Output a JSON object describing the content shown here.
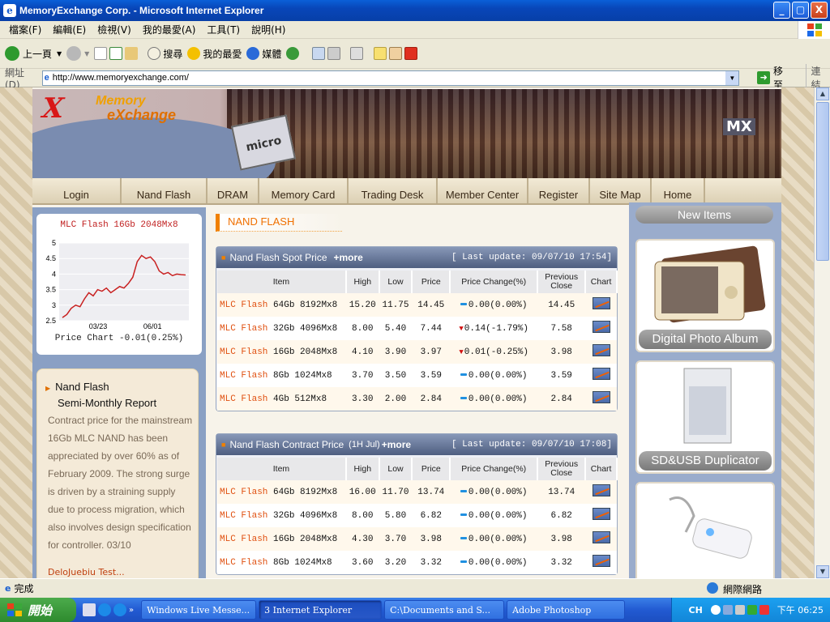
{
  "window": {
    "title": "MemoryExchange Corp. - Microsoft Internet Explorer",
    "min": "_",
    "max": "▢",
    "close": "X"
  },
  "menu": [
    "檔案(F)",
    "編輯(E)",
    "檢視(V)",
    "我的最愛(A)",
    "工具(T)",
    "說明(H)"
  ],
  "toolbar": {
    "back": "上一頁",
    "search": "搜尋",
    "favorites": "我的最愛",
    "media": "媒體"
  },
  "address": {
    "label": "網址(D)",
    "url": "http://www.memoryexchange.com/",
    "go": "移至",
    "links": "連結"
  },
  "site": {
    "logo_line1": "Memory",
    "logo_line2": "eXchange",
    "logo_x": "X",
    "banner_tag": "MX",
    "sd_label": "micro SD",
    "nav": [
      "Login",
      "Nand Flash",
      "DRAM",
      "Memory Card",
      "Trading Desk",
      "Member Center",
      "Register",
      "Site Map",
      "Home"
    ],
    "section_title": "NAND FLASH",
    "side_chart": {
      "title": "MLC Flash 16Gb 2048Mx8",
      "caption": "Price Chart -0.01(0.25%)"
    },
    "report": {
      "title": "Nand Flash",
      "subtitle": "Semi-Monthly Report",
      "body": "Contract price for the mainstream 16Gb MLC NAND has been appreciated by over 60% as of February 2009. The strong surge is driven by a straining supply due to process migration, which also involves design specification for controller. 03/10",
      "link": "DeloJuebiu Test..."
    },
    "spot": {
      "title": "Nand Flash Spot Price",
      "more": "+more",
      "update": "[ Last update: 09/07/10 17:54]"
    },
    "contract": {
      "title": "Nand Flash Contract Price",
      "sub": "(1H Jul)",
      "more": "+more",
      "update": "[ Last update: 09/07/10 17:08]"
    },
    "columns": [
      "Item",
      "High",
      "Low",
      "Price",
      "Price Change(%)",
      "Previous Close",
      "Chart"
    ],
    "new_items": "New Items",
    "products": [
      "Digital Photo Album",
      "SD&USB  Duplicator"
    ]
  },
  "spot_rows": [
    {
      "prefix": "MLC Flash",
      "item": "64Gb 8192Mx8",
      "high": "15.20",
      "low": "11.75",
      "price": "14.45",
      "change": "0.00(0.00%)",
      "dir": "flat",
      "prev": "14.45"
    },
    {
      "prefix": "MLC Flash",
      "item": "32Gb 4096Mx8",
      "high": "8.00",
      "low": "5.40",
      "price": "7.44",
      "change": "0.14(-1.79%)",
      "dir": "down",
      "prev": "7.58"
    },
    {
      "prefix": "MLC Flash",
      "item": "16Gb 2048Mx8",
      "high": "4.10",
      "low": "3.90",
      "price": "3.97",
      "change": "0.01(-0.25%)",
      "dir": "down",
      "prev": "3.98"
    },
    {
      "prefix": "MLC Flash",
      "item": "8Gb 1024Mx8",
      "high": "3.70",
      "low": "3.50",
      "price": "3.59",
      "change": "0.00(0.00%)",
      "dir": "flat",
      "prev": "3.59"
    },
    {
      "prefix": "MLC Flash",
      "item": "4Gb 512Mx8",
      "high": "3.30",
      "low": "2.00",
      "price": "2.84",
      "change": "0.00(0.00%)",
      "dir": "flat",
      "prev": "2.84"
    }
  ],
  "contract_rows": [
    {
      "prefix": "MLC Flash",
      "item": "64Gb 8192Mx8",
      "high": "16.00",
      "low": "11.70",
      "price": "13.74",
      "change": "0.00(0.00%)",
      "dir": "flat",
      "prev": "13.74"
    },
    {
      "prefix": "MLC Flash",
      "item": "32Gb 4096Mx8",
      "high": "8.00",
      "low": "5.80",
      "price": "6.82",
      "change": "0.00(0.00%)",
      "dir": "flat",
      "prev": "6.82"
    },
    {
      "prefix": "MLC Flash",
      "item": "16Gb 2048Mx8",
      "high": "4.30",
      "low": "3.70",
      "price": "3.98",
      "change": "0.00(0.00%)",
      "dir": "flat",
      "prev": "3.98"
    },
    {
      "prefix": "MLC Flash",
      "item": "8Gb 1024Mx8",
      "high": "3.60",
      "low": "3.20",
      "price": "3.32",
      "change": "0.00(0.00%)",
      "dir": "flat",
      "prev": "3.32"
    }
  ],
  "chart_data": {
    "type": "line",
    "title": "MLC Flash 16Gb 2048Mx8",
    "ylim": [
      2.5,
      5
    ],
    "yticks": [
      2.5,
      3,
      3.5,
      4,
      4.5,
      5
    ],
    "xticks": [
      "03/23",
      "06/01"
    ],
    "values": [
      2.6,
      2.7,
      2.9,
      3.0,
      2.95,
      3.2,
      3.4,
      3.3,
      3.5,
      3.45,
      3.55,
      3.4,
      3.5,
      3.6,
      3.55,
      3.7,
      3.9,
      4.4,
      4.6,
      4.5,
      4.55,
      4.4,
      4.1,
      4.0,
      4.05,
      3.95,
      4.0,
      3.98,
      3.97
    ]
  },
  "status": {
    "left": "完成",
    "right": "網際網路"
  },
  "taskbar": {
    "start": "開始",
    "tasks": [
      "Windows Live Messe...",
      "3 Internet Explorer",
      "C:\\Documents and S...",
      "Adobe Photoshop"
    ],
    "lang": "CH",
    "clock": "下午 06:25"
  }
}
